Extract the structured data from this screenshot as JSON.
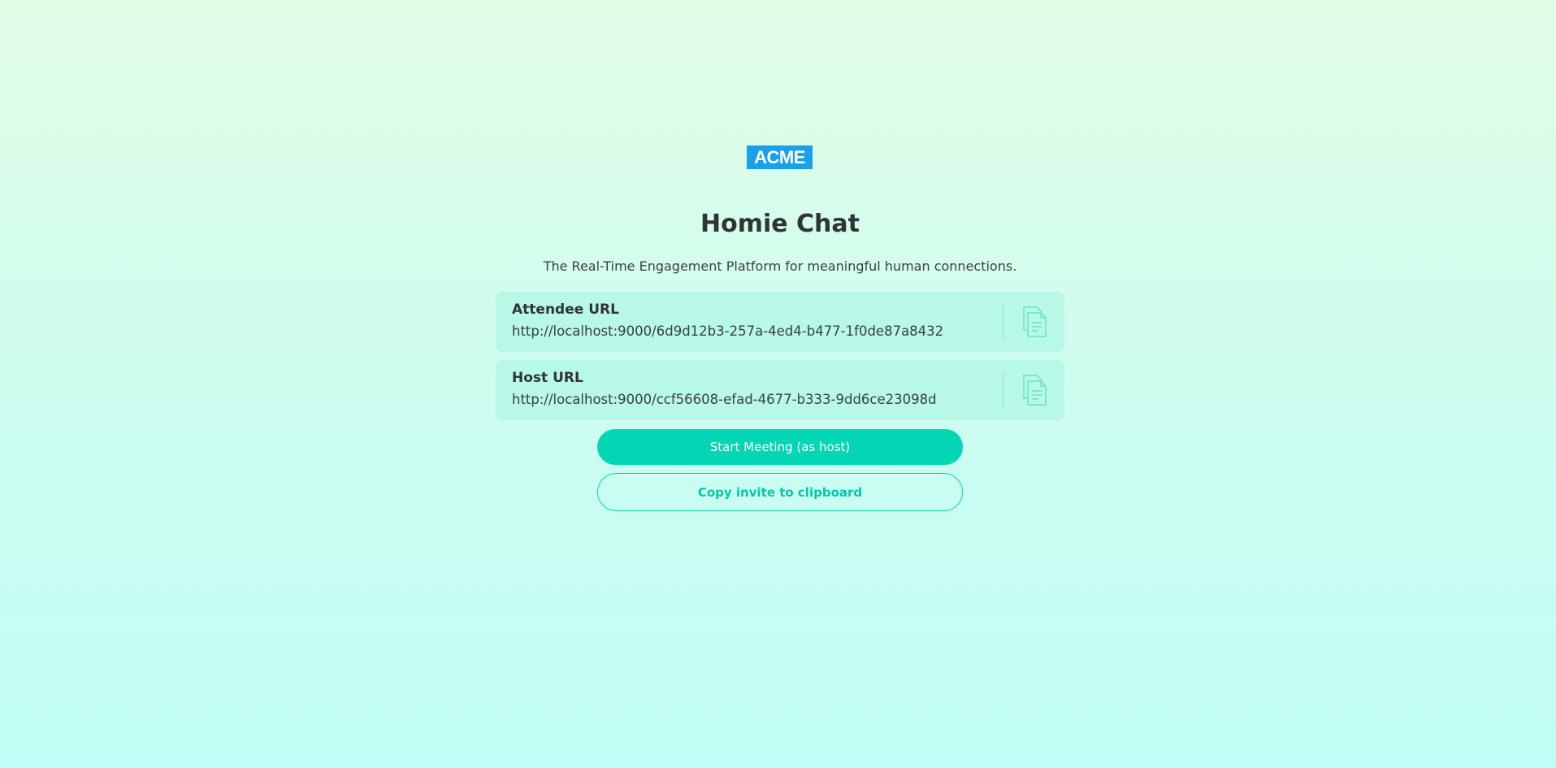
{
  "logo": {
    "text": "ACME",
    "color": "#1a9fea"
  },
  "app": {
    "title": "Homie Chat",
    "subtitle": "The Real-Time Engagement Platform for meaningful human connections."
  },
  "urls": [
    {
      "label": "Attendee URL",
      "value": "http://localhost:9000/6d9d12b3-257a-4ed4-b477-1f0de87a8432",
      "icon": "copy-icon"
    },
    {
      "label": "Host URL",
      "value": "http://localhost:9000/ccf56608-efad-4677-b333-9dd6ce23098d",
      "icon": "copy-icon"
    }
  ],
  "actions": {
    "start_meeting_label": "Start Meeting (as host)",
    "copy_invite_label": "Copy invite to clipboard"
  },
  "colors": {
    "accent": "#03d6b4",
    "card_background": "#b7f8e6",
    "background_top": "#e2fde6",
    "background_bottom": "#c1fdf6"
  }
}
